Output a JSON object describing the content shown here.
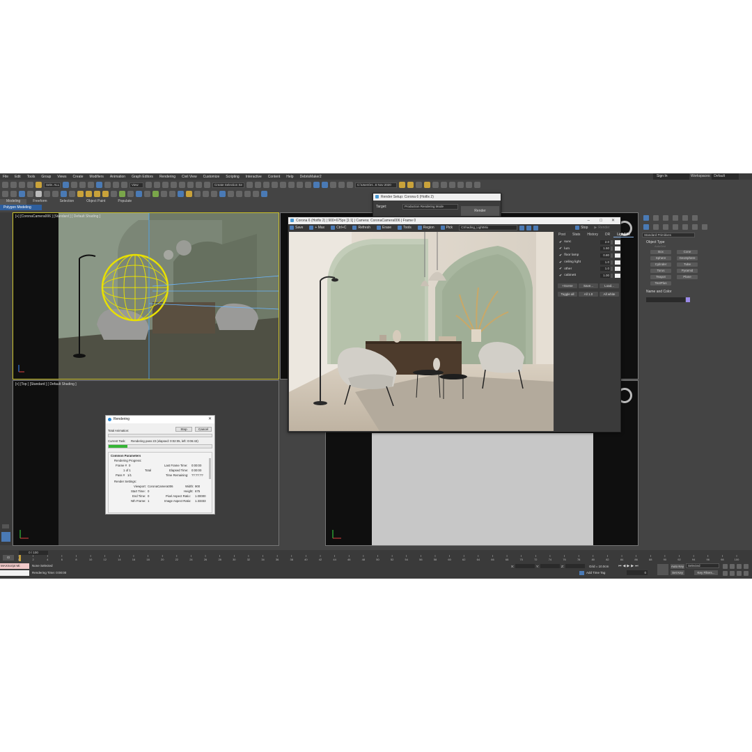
{
  "menu": [
    "File",
    "Edit",
    "Tools",
    "Group",
    "Views",
    "Create",
    "Modifiers",
    "Animation",
    "Graph Editors",
    "Rendering",
    "Civil View",
    "Customize",
    "Scripting",
    "Interactive",
    "Content",
    "Help",
    "DebrisMaker2"
  ],
  "signin": "Sign In",
  "workspaces": {
    "label": "Workspaces:",
    "value": "Default"
  },
  "toolbar": {
    "selection_filter": "Sele. ALL",
    "reference_coord": "View",
    "selection_set": "Create Selection Se",
    "project_path": "C:\\Users\\H...6 Nov 2020"
  },
  "ribbon": {
    "tabs": [
      "Modeling",
      "Freeform",
      "Selection",
      "Object Paint",
      "Populate"
    ],
    "active": "Modeling",
    "sub": "Polygon Modeling"
  },
  "viewports": {
    "camera": "[+] [CoronaCamera006 ] [Standard ] [ Default Shading ]",
    "top": "[+] [Top ] [Standard ] [ Default Shading ]"
  },
  "render_setup": {
    "title": "Render Setup: Corona 6 (Hotfix 2)",
    "target_label": "Target:",
    "target_value": "Production Rendering Mode",
    "render_button": "Render"
  },
  "vfb": {
    "title": "Corona 6 (Hotfix 2) | 900×675px [1:1] | Camera: CoronaCamera006 | Frame 0",
    "toolbar": [
      "Save",
      "+ Max",
      "Ctrl+C",
      "Refresh",
      "Erase",
      "Tools",
      "Region",
      "Pick"
    ],
    "shading": "CShading_LightMix",
    "stop": "Stop",
    "render": "Render",
    "tabs": [
      "Post",
      "Stats",
      "History",
      "DR",
      "LightMix"
    ],
    "active_tab": "LightMix",
    "lights": [
      {
        "name": "sunc",
        "value": "2.0"
      },
      {
        "name": "lum",
        "value": "1.50"
      },
      {
        "name": "floor lamp",
        "value": "0.80"
      },
      {
        "name": "ceiling light",
        "value": "1.0"
      },
      {
        "name": "other",
        "value": "1.0"
      },
      {
        "name": "cabinett",
        "value": "1.00"
      }
    ],
    "buttons_row1": [
      "+Scene",
      "Save...",
      "Load..."
    ],
    "buttons_row2": [
      "Toggle all",
      "All 1.0",
      "All white"
    ]
  },
  "command_panel": {
    "category": "Standard Primitives",
    "object_type": "Object Type",
    "autogrid": "AutoGrid",
    "primitives": [
      "Box",
      "Cone",
      "Sphere",
      "GeoSphere",
      "Cylinder",
      "Tube",
      "Torus",
      "Pyramid",
      "Teapot",
      "Plane",
      "TextPlus"
    ],
    "name_color": "Name and Color"
  },
  "rendering_dialog": {
    "title": "Rendering",
    "total_animation": "Total Animation:",
    "stop": "Stop",
    "cancel": "Cancel",
    "current_task_label": "Current Task:",
    "current_task": "Rendering pass 23 (elapsed: 0:02:05, left: 0:06:43)",
    "progress": 0.18,
    "common_params": "Common Parameters",
    "rendering_progress": "Rendering Progress:",
    "frame_label": "Frame #",
    "frame_value": "0",
    "of_label": "1 of 1",
    "total_label": "Total",
    "pass_label": "Pass #",
    "pass_value": "1/1",
    "last_frame_label": "Last Frame Time:",
    "last_frame_value": "0:00:00",
    "elapsed_label": "Elapsed Time:",
    "elapsed_value": "0:00:00",
    "remaining_label": "Time Remaining:",
    "remaining_value": "??:??:??",
    "render_settings": "Render Settings:",
    "viewport_label": "Viewport:",
    "viewport_value": "CoronaCamera006",
    "width_label": "Width:",
    "width_value": "900",
    "start_label": "Start Time:",
    "start_value": "0",
    "height_label": "Height:",
    "height_value": "675",
    "end_label": "End Time:",
    "end_value": "0",
    "pixel_aspect_label": "Pixel Aspect Ratio:",
    "pixel_aspect_value": "1.00000",
    "nth_label": "Nth Frame:",
    "nth_value": "1",
    "image_aspect_label": "Image Aspect Ratio:",
    "image_aspect_value": "1.33333"
  },
  "timeline": {
    "frame": "0 / 100",
    "ticks": [
      "0",
      "2",
      "4",
      "6",
      "8",
      "10",
      "12",
      "14",
      "16",
      "18",
      "20",
      "22",
      "24",
      "26",
      "28",
      "30",
      "32",
      "34",
      "36",
      "38",
      "40",
      "42",
      "44",
      "46",
      "48",
      "50",
      "52",
      "54",
      "56",
      "58",
      "60",
      "62",
      "64",
      "66",
      "68",
      "70",
      "72",
      "74",
      "76",
      "78",
      "80",
      "82",
      "84",
      "86",
      "88",
      "90",
      "92",
      "94",
      "96",
      "98",
      "100"
    ]
  },
  "status": {
    "maxscript": "MAXScript Mi:",
    "selection": "None Selected",
    "render_time": "Rendering Time: 0:00:00",
    "x_label": "X:",
    "y_label": "Y:",
    "z_label": "Z:",
    "grid": "Grid = 10.0cm",
    "add_time_tag": "Add Time Tag",
    "auto_key": "Auto Key",
    "selected": "Selected",
    "set_key": "Set Key",
    "key_filters": "Key Filters...",
    "current_frame": "0"
  },
  "colors": {
    "selected_light": "#e8e000",
    "accent": "#4a7ab5",
    "progress": "#35b535"
  }
}
